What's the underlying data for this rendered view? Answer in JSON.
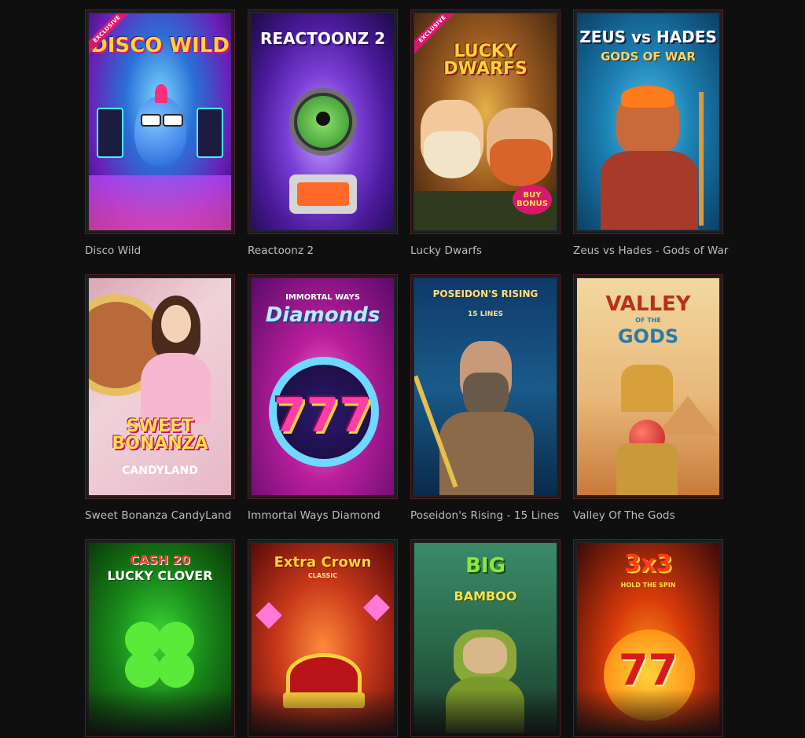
{
  "games": [
    {
      "title": "Disco Wild",
      "logo": "DISCO WILD",
      "ribbon": "EXCLUSIVE"
    },
    {
      "title": "Reactoonz 2",
      "logo": "REACTOONZ 2"
    },
    {
      "title": "Lucky Dwarfs",
      "logo": "LUCKY DWARFS",
      "ribbon": "EXCLUSIVE",
      "badge": "BUY BONUS"
    },
    {
      "title": "Zeus vs Hades - Gods of War",
      "logo": "ZEUS vs HADES",
      "sublogo": "GODS OF WAR"
    },
    {
      "title": "Sweet Bonanza CandyLand",
      "logo": "SWEET BONANZA",
      "sublogo": "CANDYLAND"
    },
    {
      "title": "Immortal Ways Diamond",
      "logo": "Diamonds",
      "sublogo": "IMMORTAL WAYS"
    },
    {
      "title": "Poseidon's Rising - 15 Lines",
      "logo": "POSEIDON'S RISING",
      "sublogo": "15 LINES"
    },
    {
      "title": "Valley Of The Gods",
      "logo": "VALLEY",
      "sublogo": "GODS",
      "midlogo": "OF THE"
    },
    {
      "title": "",
      "logo": "CASH 20",
      "sublogo": "LUCKY CLOVER"
    },
    {
      "title": "",
      "logo": "Extra Crown",
      "sublogo": "CLASSIC"
    },
    {
      "title": "",
      "logo": "BIG",
      "sublogo": "BAMBOO"
    },
    {
      "title": "",
      "logo": "3x3",
      "sublogo": "HOLD THE SPIN"
    }
  ]
}
